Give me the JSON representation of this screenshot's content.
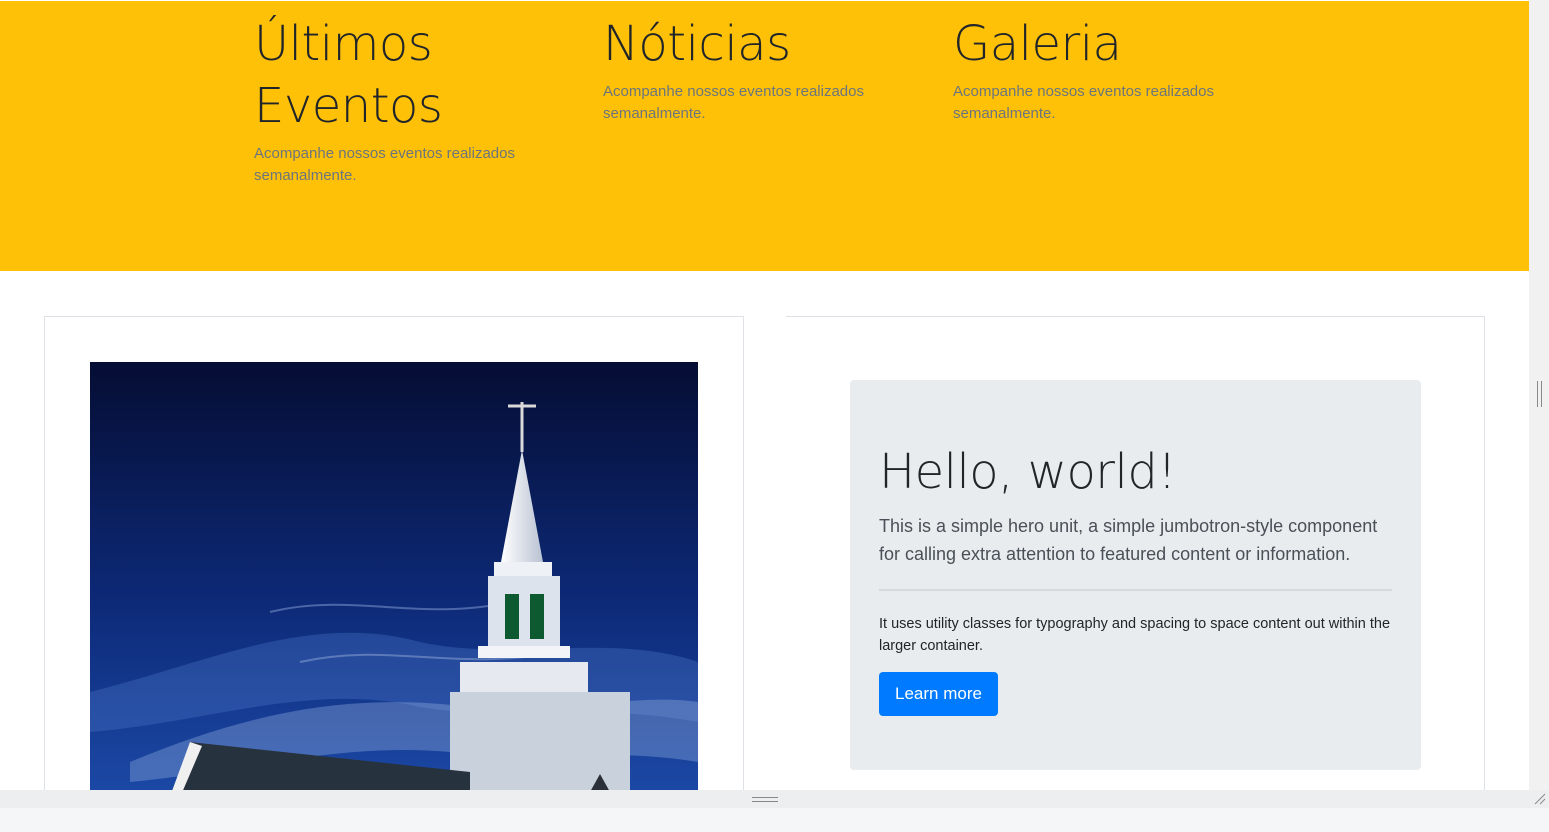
{
  "hero": {
    "background_color": "#fec107",
    "columns": [
      {
        "title": "Últimos Eventos",
        "subtitle": "Acompanhe nossos eventos realizados semanalmente."
      },
      {
        "title": "Nóticias",
        "subtitle": "Acompanhe nossos eventos realizados semanalmente."
      },
      {
        "title": "Galeria",
        "subtitle": "Acompanhe nossos eventos realizados semanalmente."
      }
    ]
  },
  "jumbotron": {
    "heading": "Hello, world!",
    "lead": "This is a simple hero unit, a simple jumbotron-style component for calling extra attention to featured content or information.",
    "body": "It uses utility classes for typography and spacing to space content out within the larger container.",
    "button_label": "Learn more",
    "button_color": "#007bff"
  },
  "image": {
    "icon": "church-photo"
  }
}
